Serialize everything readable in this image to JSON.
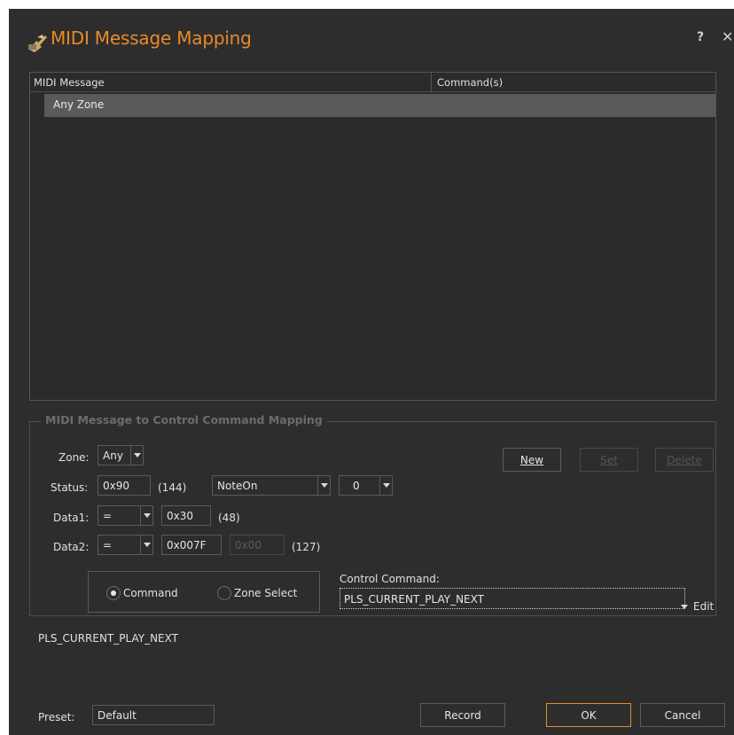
{
  "window": {
    "title": "MIDI Message Mapping",
    "help": "?",
    "close": "✕"
  },
  "list": {
    "columns": [
      "MIDI Message",
      "Command(s)"
    ],
    "rows": [
      {
        "midi_message": "Any Zone",
        "commands": ""
      }
    ]
  },
  "mapping": {
    "group_title": "MIDI Message to Control Command Mapping",
    "zone": {
      "label": "Zone:",
      "value": "Any"
    },
    "status": {
      "label": "Status:",
      "hex": "0x90",
      "dec": "(144)",
      "type": "NoteOn",
      "channel": "0"
    },
    "data1": {
      "label": "Data1:",
      "op": "=",
      "hex": "0x30",
      "dec": "(48)"
    },
    "data2": {
      "label": "Data2:",
      "op": "=",
      "hex": "0x007F",
      "hex2": "0x00",
      "dec": "(127)"
    },
    "buttons": {
      "new": "New",
      "set": "Set",
      "delete": "Delete"
    },
    "radio": {
      "command": "Command",
      "zone_select": "Zone Select",
      "selected": "command"
    },
    "control_command": {
      "label": "Control Command:",
      "value": "PLS_CURRENT_PLAY_NEXT",
      "edit": "Edit"
    }
  },
  "description": "PLS_CURRENT_PLAY_NEXT",
  "footer": {
    "preset_label": "Preset:",
    "preset_value": "Default",
    "record": "Record",
    "ok": "OK",
    "cancel": "Cancel"
  },
  "colors": {
    "accent": "#e8892a",
    "background": "#2d2d2d",
    "selected_row": "#5a5a5a"
  }
}
